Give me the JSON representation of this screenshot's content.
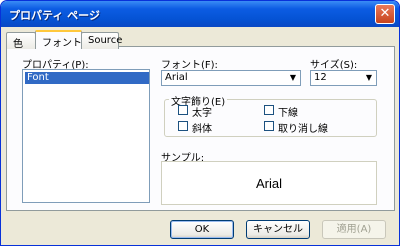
{
  "window": {
    "title": "プロパティ ページ"
  },
  "tabs": [
    {
      "label": "色"
    },
    {
      "label": "フォント"
    },
    {
      "label": "Source"
    }
  ],
  "property_list": {
    "label": "プロパティ(P):",
    "items": [
      "Font"
    ],
    "selected": "Font"
  },
  "font": {
    "label": "フォント(F):",
    "value": "Arial"
  },
  "size": {
    "label": "サイズ(S):",
    "value": "12"
  },
  "effects": {
    "label": "文字飾り(E)",
    "bold": "太字",
    "italic": "斜体",
    "underline": "下線",
    "strikeout": "取り消し線"
  },
  "sample": {
    "label": "サンプル:",
    "text": "Arial"
  },
  "buttons": {
    "ok": "OK",
    "cancel": "キャンセル",
    "apply": "適用(A)"
  }
}
